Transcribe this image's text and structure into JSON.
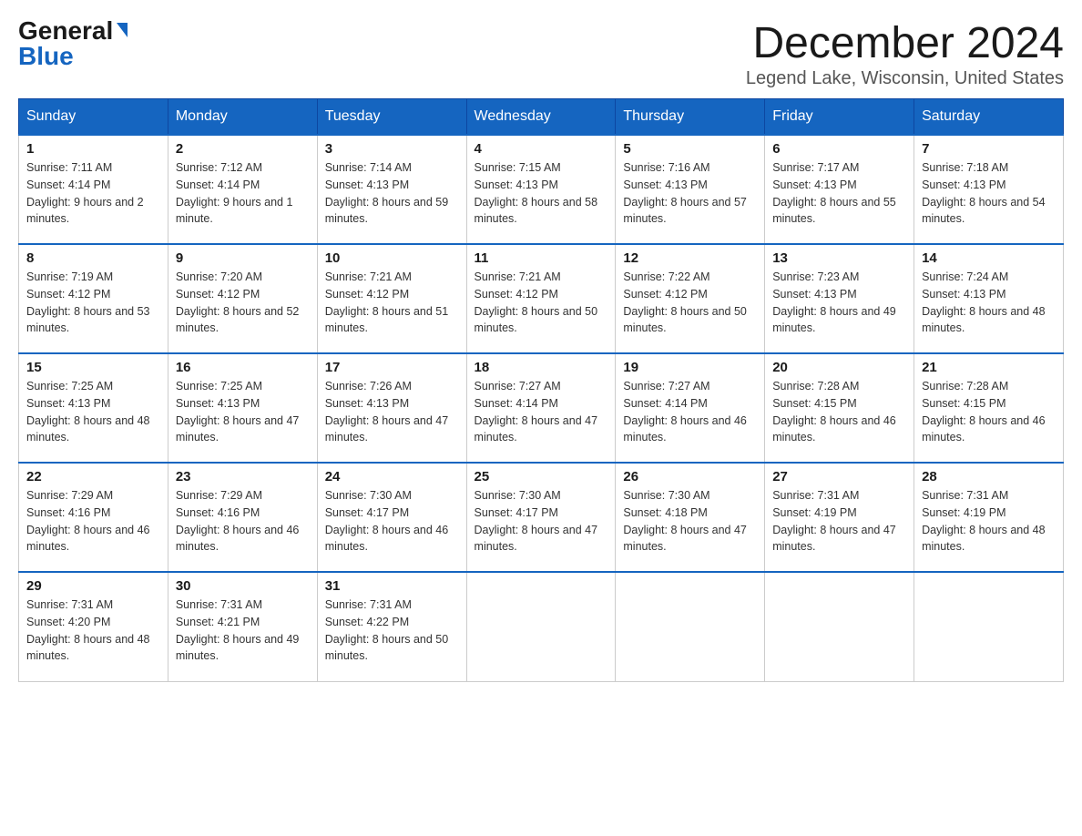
{
  "header": {
    "logo_general": "General",
    "logo_blue": "Blue",
    "month_title": "December 2024",
    "location": "Legend Lake, Wisconsin, United States"
  },
  "days_of_week": [
    "Sunday",
    "Monday",
    "Tuesday",
    "Wednesday",
    "Thursday",
    "Friday",
    "Saturday"
  ],
  "weeks": [
    [
      {
        "day": "1",
        "sunrise": "7:11 AM",
        "sunset": "4:14 PM",
        "daylight": "9 hours and 2 minutes."
      },
      {
        "day": "2",
        "sunrise": "7:12 AM",
        "sunset": "4:14 PM",
        "daylight": "9 hours and 1 minute."
      },
      {
        "day": "3",
        "sunrise": "7:14 AM",
        "sunset": "4:13 PM",
        "daylight": "8 hours and 59 minutes."
      },
      {
        "day": "4",
        "sunrise": "7:15 AM",
        "sunset": "4:13 PM",
        "daylight": "8 hours and 58 minutes."
      },
      {
        "day": "5",
        "sunrise": "7:16 AM",
        "sunset": "4:13 PM",
        "daylight": "8 hours and 57 minutes."
      },
      {
        "day": "6",
        "sunrise": "7:17 AM",
        "sunset": "4:13 PM",
        "daylight": "8 hours and 55 minutes."
      },
      {
        "day": "7",
        "sunrise": "7:18 AM",
        "sunset": "4:13 PM",
        "daylight": "8 hours and 54 minutes."
      }
    ],
    [
      {
        "day": "8",
        "sunrise": "7:19 AM",
        "sunset": "4:12 PM",
        "daylight": "8 hours and 53 minutes."
      },
      {
        "day": "9",
        "sunrise": "7:20 AM",
        "sunset": "4:12 PM",
        "daylight": "8 hours and 52 minutes."
      },
      {
        "day": "10",
        "sunrise": "7:21 AM",
        "sunset": "4:12 PM",
        "daylight": "8 hours and 51 minutes."
      },
      {
        "day": "11",
        "sunrise": "7:21 AM",
        "sunset": "4:12 PM",
        "daylight": "8 hours and 50 minutes."
      },
      {
        "day": "12",
        "sunrise": "7:22 AM",
        "sunset": "4:12 PM",
        "daylight": "8 hours and 50 minutes."
      },
      {
        "day": "13",
        "sunrise": "7:23 AM",
        "sunset": "4:13 PM",
        "daylight": "8 hours and 49 minutes."
      },
      {
        "day": "14",
        "sunrise": "7:24 AM",
        "sunset": "4:13 PM",
        "daylight": "8 hours and 48 minutes."
      }
    ],
    [
      {
        "day": "15",
        "sunrise": "7:25 AM",
        "sunset": "4:13 PM",
        "daylight": "8 hours and 48 minutes."
      },
      {
        "day": "16",
        "sunrise": "7:25 AM",
        "sunset": "4:13 PM",
        "daylight": "8 hours and 47 minutes."
      },
      {
        "day": "17",
        "sunrise": "7:26 AM",
        "sunset": "4:13 PM",
        "daylight": "8 hours and 47 minutes."
      },
      {
        "day": "18",
        "sunrise": "7:27 AM",
        "sunset": "4:14 PM",
        "daylight": "8 hours and 47 minutes."
      },
      {
        "day": "19",
        "sunrise": "7:27 AM",
        "sunset": "4:14 PM",
        "daylight": "8 hours and 46 minutes."
      },
      {
        "day": "20",
        "sunrise": "7:28 AM",
        "sunset": "4:15 PM",
        "daylight": "8 hours and 46 minutes."
      },
      {
        "day": "21",
        "sunrise": "7:28 AM",
        "sunset": "4:15 PM",
        "daylight": "8 hours and 46 minutes."
      }
    ],
    [
      {
        "day": "22",
        "sunrise": "7:29 AM",
        "sunset": "4:16 PM",
        "daylight": "8 hours and 46 minutes."
      },
      {
        "day": "23",
        "sunrise": "7:29 AM",
        "sunset": "4:16 PM",
        "daylight": "8 hours and 46 minutes."
      },
      {
        "day": "24",
        "sunrise": "7:30 AM",
        "sunset": "4:17 PM",
        "daylight": "8 hours and 46 minutes."
      },
      {
        "day": "25",
        "sunrise": "7:30 AM",
        "sunset": "4:17 PM",
        "daylight": "8 hours and 47 minutes."
      },
      {
        "day": "26",
        "sunrise": "7:30 AM",
        "sunset": "4:18 PM",
        "daylight": "8 hours and 47 minutes."
      },
      {
        "day": "27",
        "sunrise": "7:31 AM",
        "sunset": "4:19 PM",
        "daylight": "8 hours and 47 minutes."
      },
      {
        "day": "28",
        "sunrise": "7:31 AM",
        "sunset": "4:19 PM",
        "daylight": "8 hours and 48 minutes."
      }
    ],
    [
      {
        "day": "29",
        "sunrise": "7:31 AM",
        "sunset": "4:20 PM",
        "daylight": "8 hours and 48 minutes."
      },
      {
        "day": "30",
        "sunrise": "7:31 AM",
        "sunset": "4:21 PM",
        "daylight": "8 hours and 49 minutes."
      },
      {
        "day": "31",
        "sunrise": "7:31 AM",
        "sunset": "4:22 PM",
        "daylight": "8 hours and 50 minutes."
      },
      null,
      null,
      null,
      null
    ]
  ],
  "labels": {
    "sunrise": "Sunrise:",
    "sunset": "Sunset:",
    "daylight": "Daylight:"
  }
}
